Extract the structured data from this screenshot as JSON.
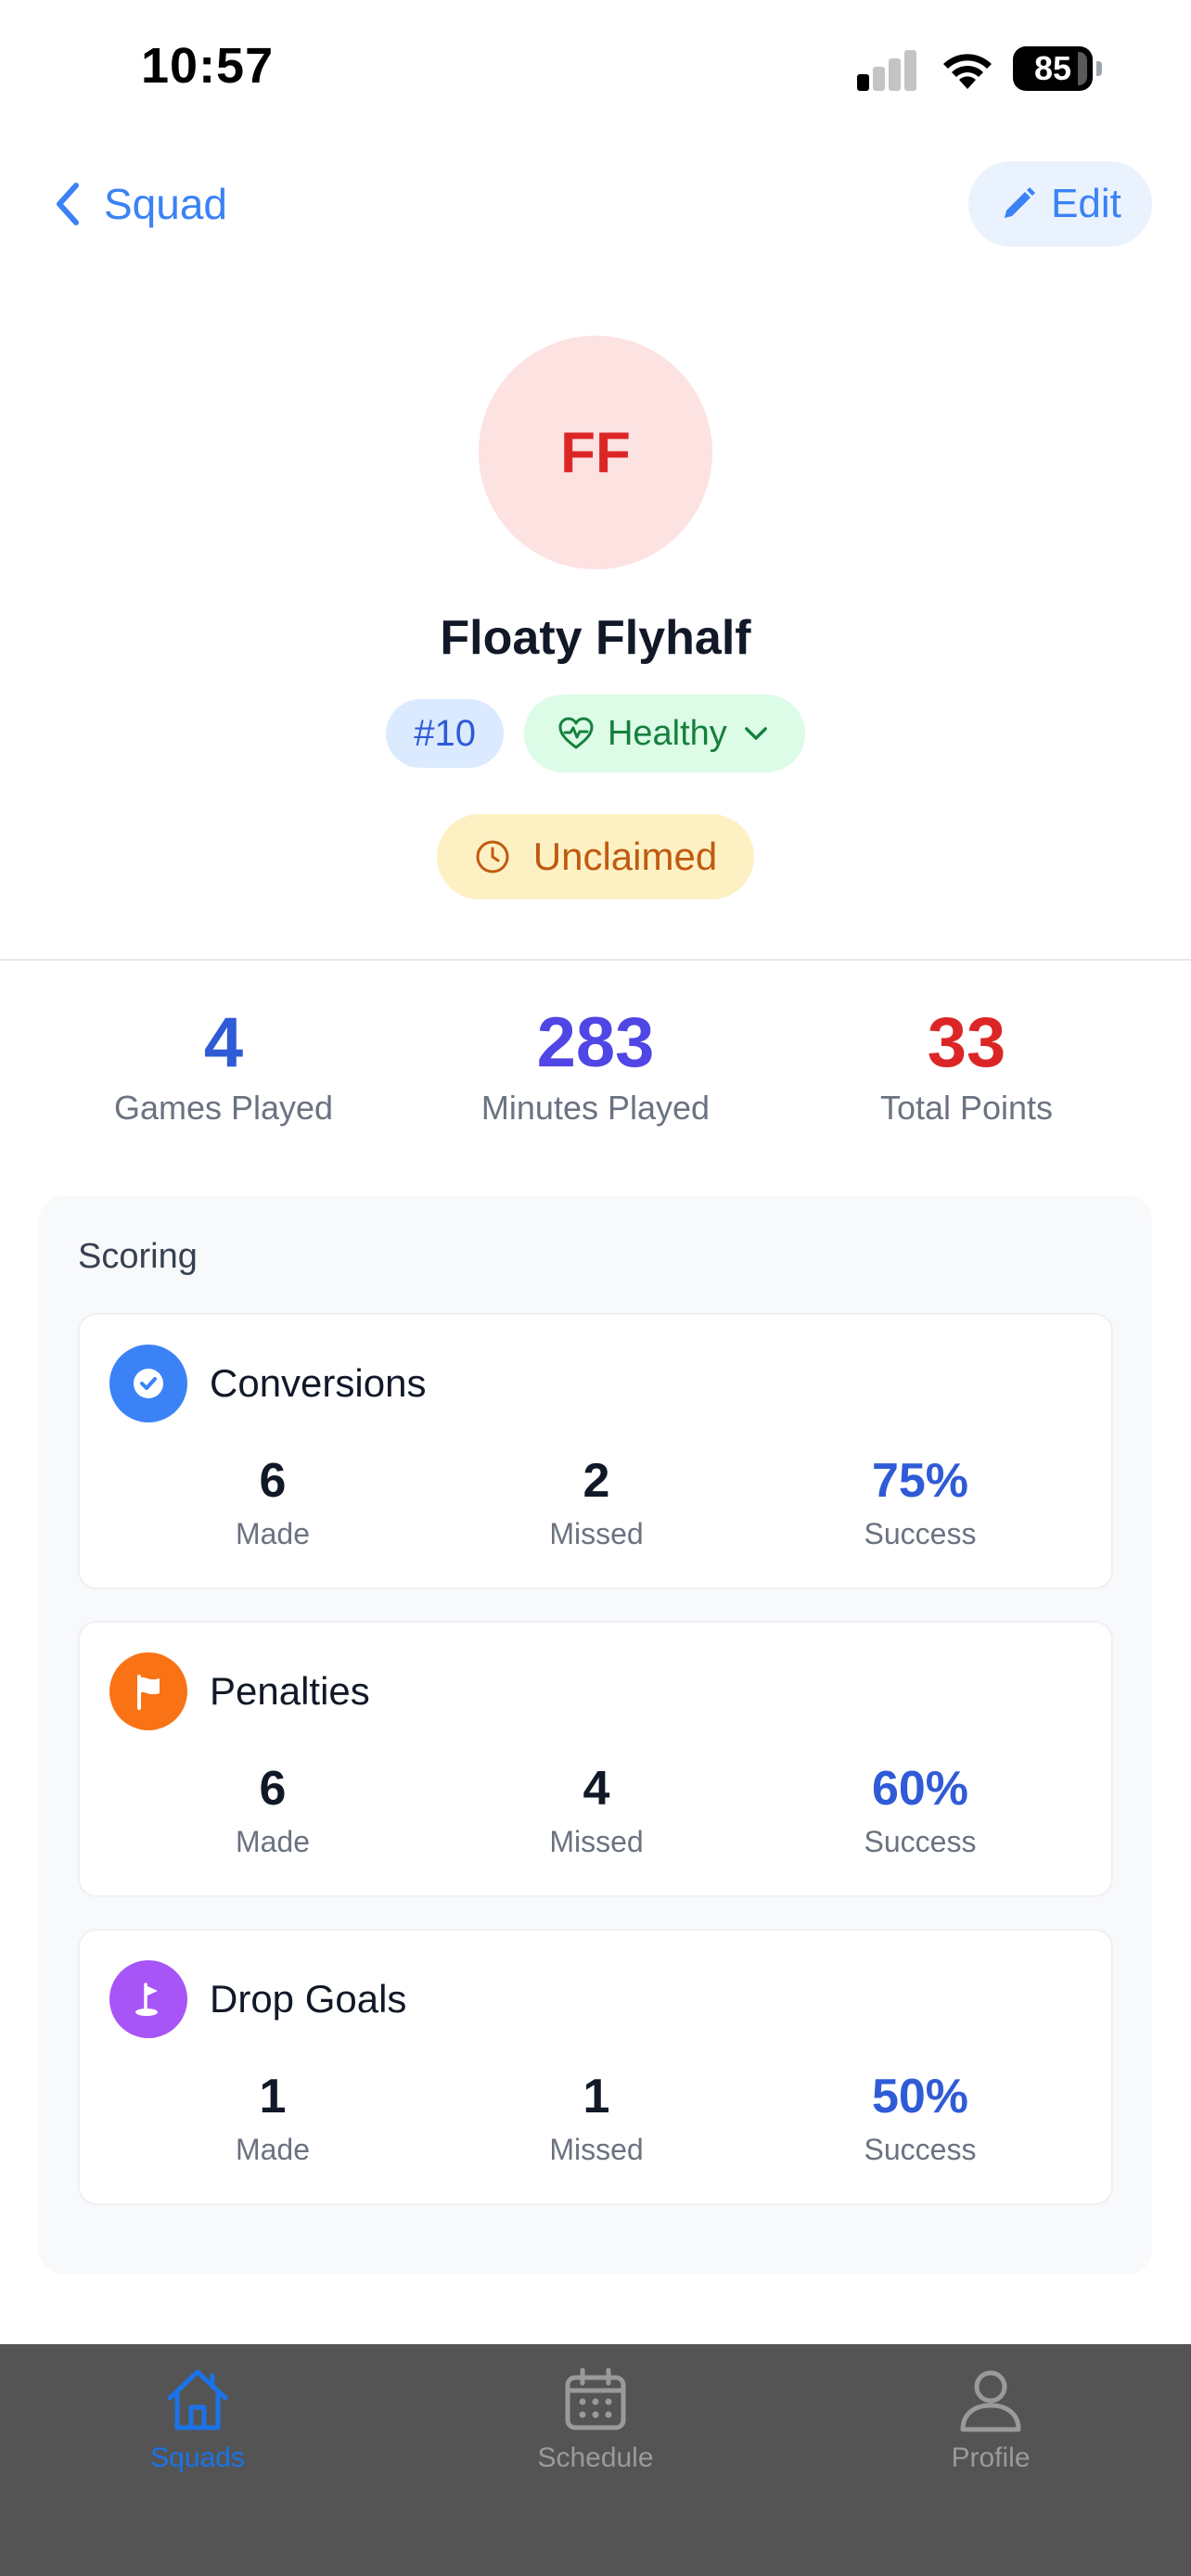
{
  "status_bar": {
    "time": "10:57",
    "battery": "85"
  },
  "nav": {
    "back_label": "Squad",
    "edit_label": "Edit"
  },
  "player": {
    "initials": "FF",
    "name": "Floaty Flyhalf",
    "number": "#10",
    "health": "Healthy",
    "claim_status": "Unclaimed"
  },
  "summary": [
    {
      "value": "4",
      "label": "Games Played",
      "color": "#2f5bd6"
    },
    {
      "value": "283",
      "label": "Minutes Played",
      "color": "#4f46e5"
    },
    {
      "value": "33",
      "label": "Total Points",
      "color": "#dc2626"
    }
  ],
  "scoring": {
    "title": "Scoring",
    "cards": [
      {
        "title": "Conversions",
        "icon": "check-circle-icon",
        "icon_color": "#3b82f6",
        "made": "6",
        "made_label": "Made",
        "missed": "2",
        "missed_label": "Missed",
        "success": "75%",
        "success_label": "Success"
      },
      {
        "title": "Penalties",
        "icon": "flag-icon",
        "icon_color": "#f97316",
        "made": "6",
        "made_label": "Made",
        "missed": "4",
        "missed_label": "Missed",
        "success": "60%",
        "success_label": "Success"
      },
      {
        "title": "Drop Goals",
        "icon": "golf-flag-icon",
        "icon_color": "#a855f7",
        "made": "1",
        "made_label": "Made",
        "missed": "1",
        "missed_label": "Missed",
        "success": "50%",
        "success_label": "Success"
      }
    ]
  },
  "tabs": [
    {
      "label": "Squads",
      "icon": "home-icon",
      "active": true
    },
    {
      "label": "Schedule",
      "icon": "calendar-icon",
      "active": false
    },
    {
      "label": "Profile",
      "icon": "person-icon",
      "active": false
    }
  ]
}
